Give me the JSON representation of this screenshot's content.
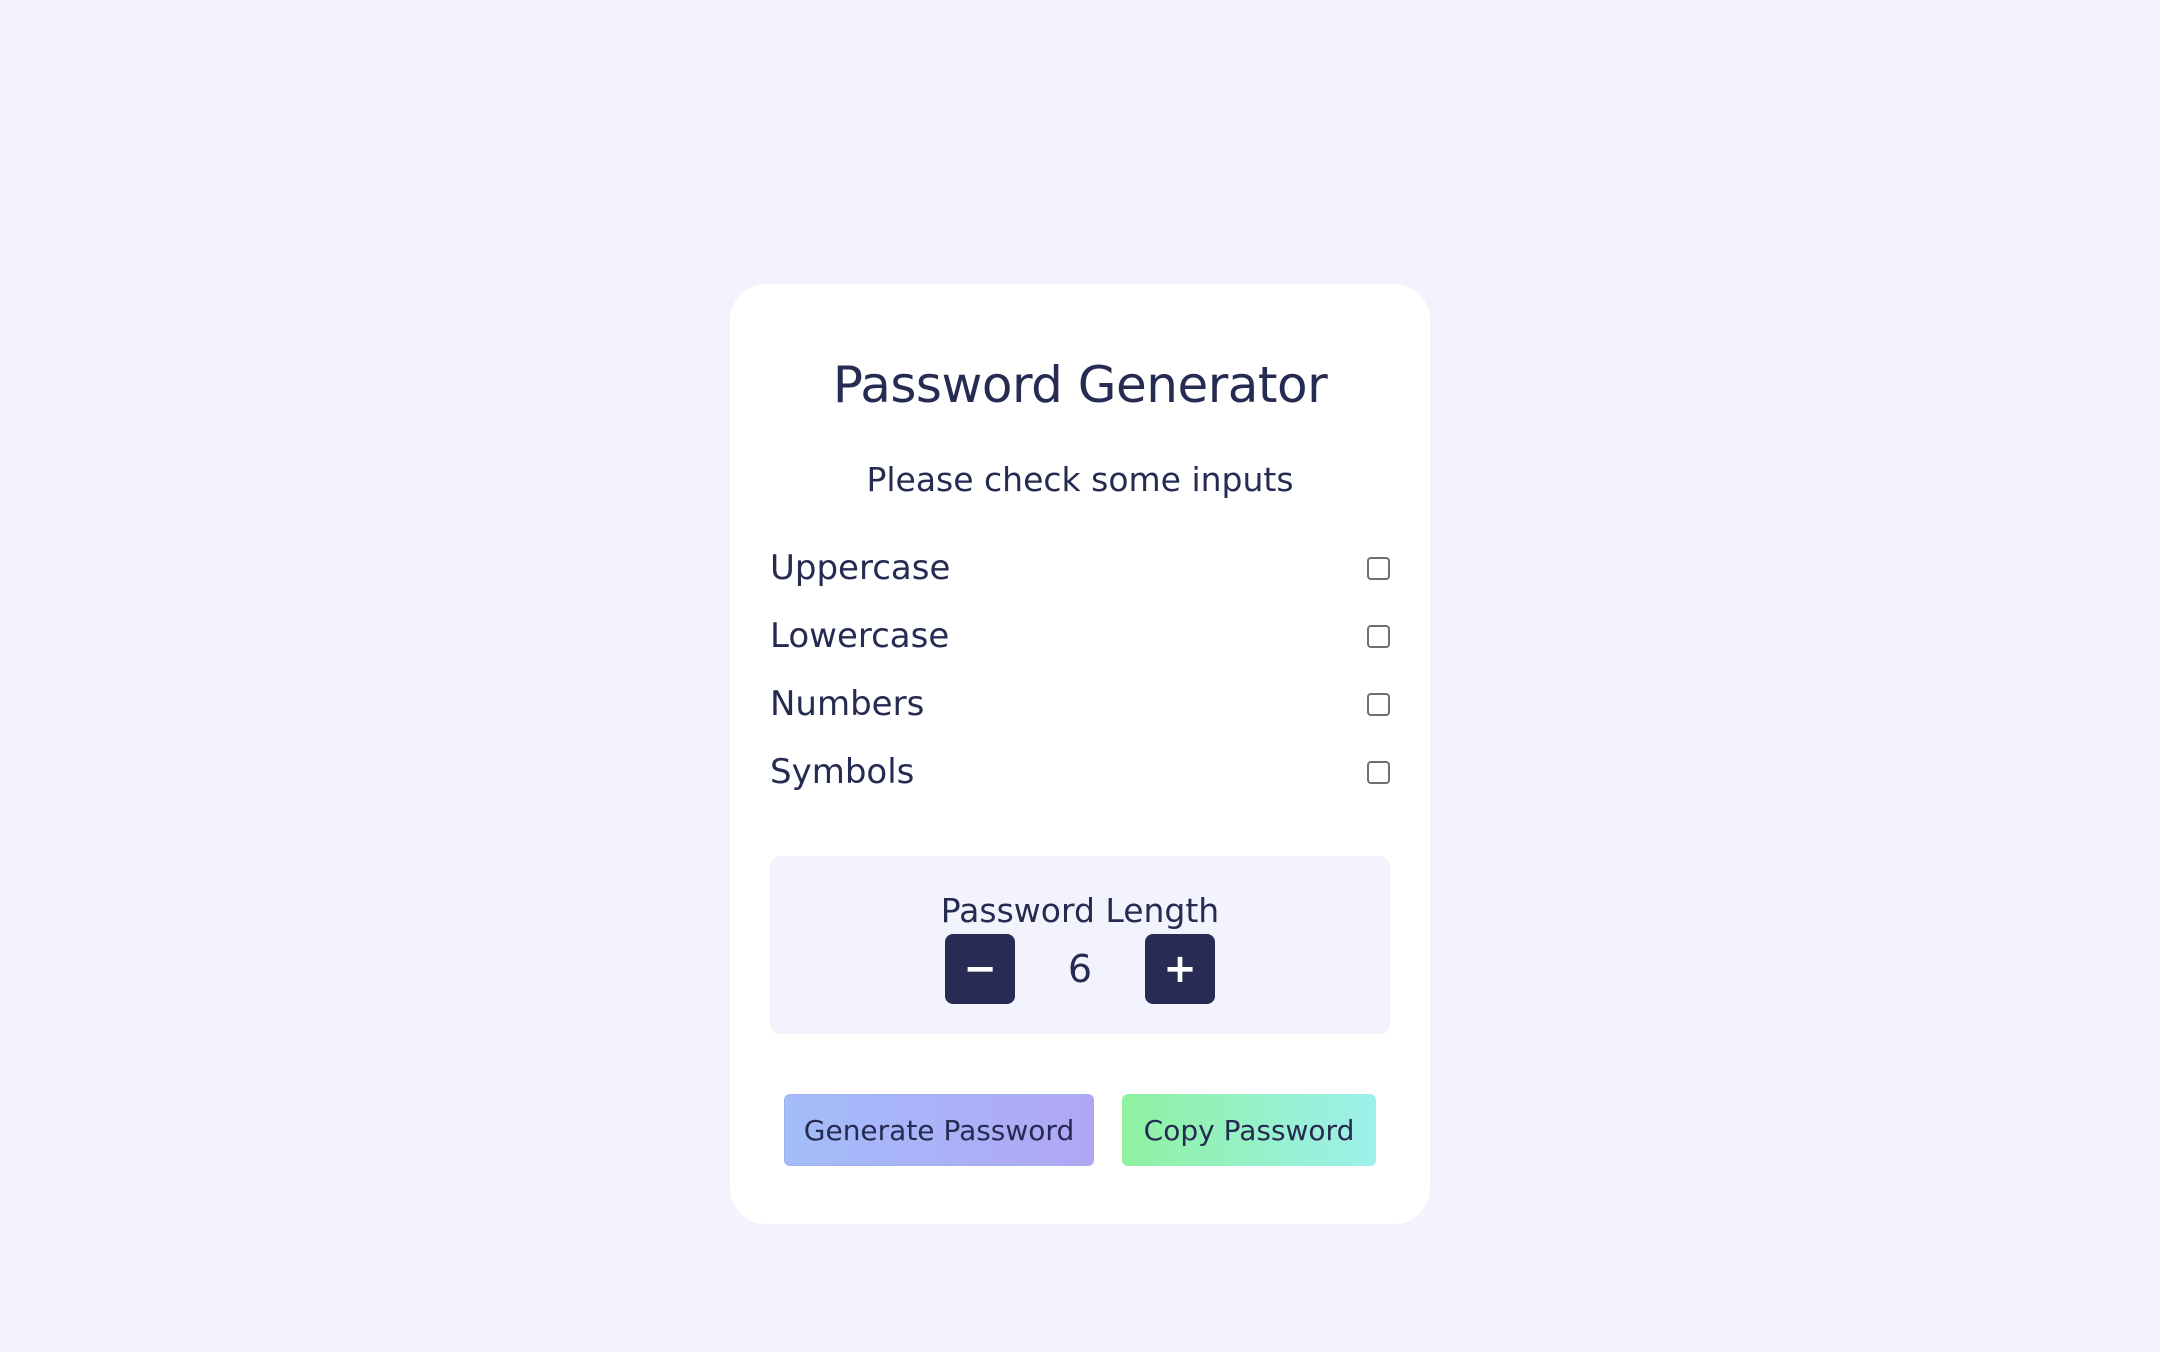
{
  "app": {
    "title": "Password Generator",
    "subtitle": "Please check some inputs"
  },
  "options": [
    {
      "label": "Uppercase",
      "checked": false
    },
    {
      "label": "Lowercase",
      "checked": false
    },
    {
      "label": "Numbers",
      "checked": false
    },
    {
      "label": "Symbols",
      "checked": false
    }
  ],
  "length": {
    "label": "Password Length",
    "value": "6",
    "decrement_label": "−",
    "increment_label": "+"
  },
  "actions": {
    "generate_label": "Generate Password",
    "copy_label": "Copy Password"
  },
  "colors": {
    "background": "#f3f3fd",
    "text": "#262b51",
    "stepper_button": "#282c54",
    "generate_gradient_start": "#a3bdfa",
    "generate_gradient_end": "#b1a6f5",
    "copy_gradient_start": "#8ef2a0",
    "copy_gradient_end": "#9ef0ec"
  }
}
